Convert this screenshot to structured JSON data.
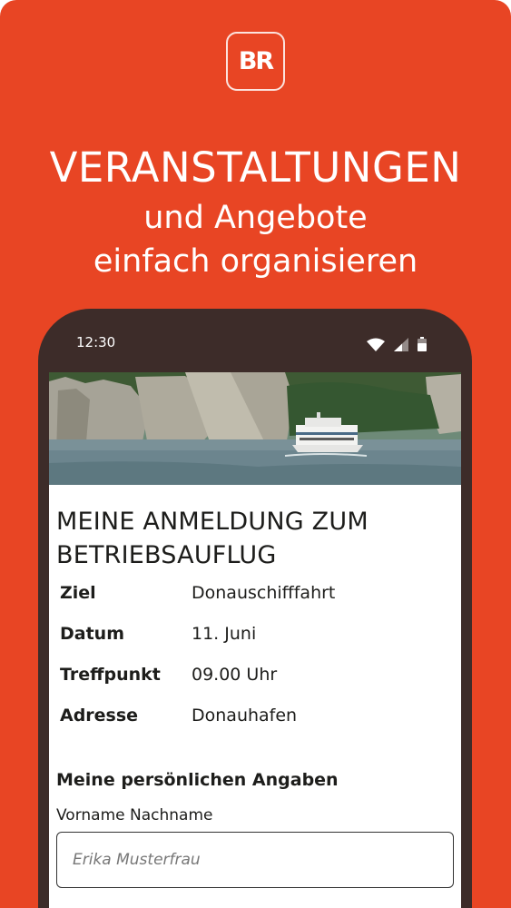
{
  "brand": {
    "logo_text": "BR"
  },
  "promo": {
    "headline": "VERANSTALTUNGEN",
    "subline_1": "und Angebote",
    "subline_2": "einfach organisieren"
  },
  "phone": {
    "status_time": "12:30",
    "status_icons": [
      "wifi-icon",
      "signal-icon",
      "battery-icon"
    ]
  },
  "form": {
    "title_line_1": "MEINE ANMELDUNG ZUM",
    "title_line_2": "BETRIEBSAUFLUG",
    "details": [
      {
        "label": "Ziel",
        "value": "Donauschifffahrt"
      },
      {
        "label": "Datum",
        "value": "11. Juni"
      },
      {
        "label": "Treffpunkt",
        "value": "09.00 Uhr"
      },
      {
        "label": "Adresse",
        "value": "Donauhafen"
      }
    ],
    "section_heading": "Meine persönlichen Angaben",
    "name_field": {
      "label": "Vorname Nachname",
      "placeholder": "Erika Musterfrau"
    }
  },
  "colors": {
    "background": "#e84524",
    "phone_frame": "#3d2c29",
    "text": "#1d1d1b"
  }
}
